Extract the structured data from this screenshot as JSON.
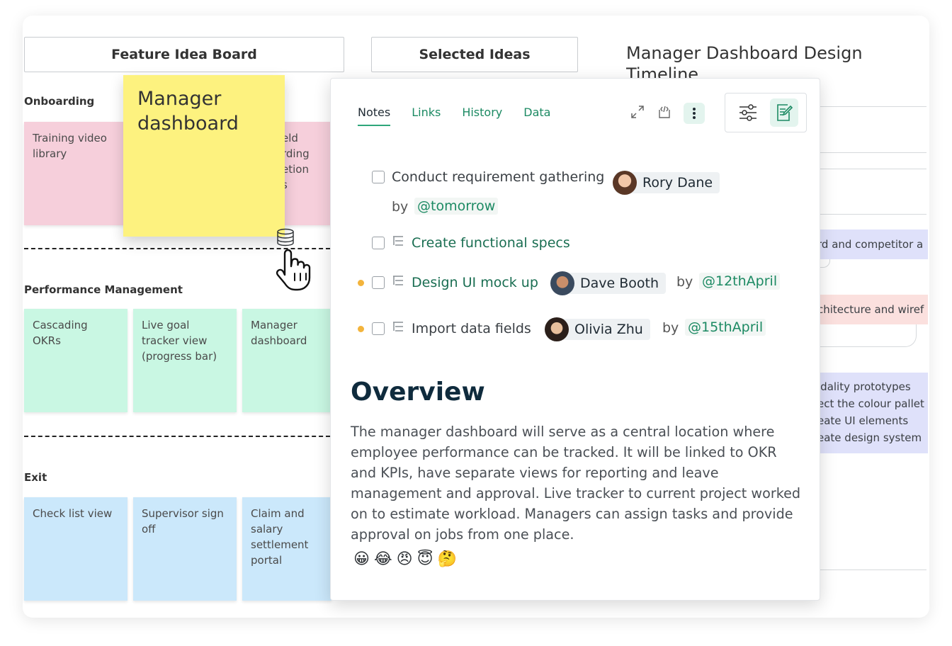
{
  "board": {
    "col_feature": "Feature Idea Board",
    "col_selected": "Selected Ideas",
    "sections": [
      {
        "label": "Onboarding",
        "stickies": [
          "Training video library",
          "eld\nrding\netion\ns"
        ]
      },
      {
        "label": "Performance Management",
        "stickies": [
          "Cascading OKRs",
          "Live goal tracker view (progress bar)",
          "Manager dashboard"
        ]
      },
      {
        "label": "Exit",
        "stickies": [
          "Check list view",
          "Supervisor sign off",
          "Claim and salary settlement portal"
        ]
      }
    ],
    "dragged_sticky": "Manager dashboard"
  },
  "timeline": {
    "title": "Manager Dashboard Design Timeline",
    "bar1": "rd and competitor a",
    "bar2": "chitecture and wiref",
    "block_lines": [
      "idality prototypes",
      "ect the colour pallet",
      "eate UI elements",
      "eate design system"
    ]
  },
  "panel": {
    "tabs": [
      "Notes",
      "Links",
      "History",
      "Data"
    ],
    "tasks": [
      {
        "text": "Conduct requirement gathering",
        "assignee": "Rory Dane",
        "by": "by",
        "date": "@tomorrow"
      },
      {
        "text": "Create functional specs"
      },
      {
        "text": "Design UI mock up",
        "assignee": "Dave Booth",
        "by": "by",
        "date": "@12thApril"
      },
      {
        "text": "Import data fields",
        "assignee": "Olivia Zhu",
        "by": "by",
        "date": "@15thApril"
      }
    ],
    "overview_title": "Overview",
    "overview_body": "The manager dashboard will serve as a central location where employee performance can be tracked. It will be linked to OKR and KPIs, have separate views for reporting and leave management and approval.  Live tracker to current project worked on to estimate workload. Managers can assign tasks and provide approval on jobs from one place.",
    "emojis": [
      "😀",
      "😂",
      "😠",
      "😇",
      "🤔"
    ]
  },
  "colors": {
    "accent_green": "#1c8a63",
    "sticky_yellow": "#fdf27f",
    "sticky_pink": "#f6cfdb",
    "sticky_green": "#c9f7e3",
    "sticky_blue": "#cbe8fb",
    "timeline_purple": "#dfe1fa",
    "timeline_red": "#fbe0de"
  }
}
